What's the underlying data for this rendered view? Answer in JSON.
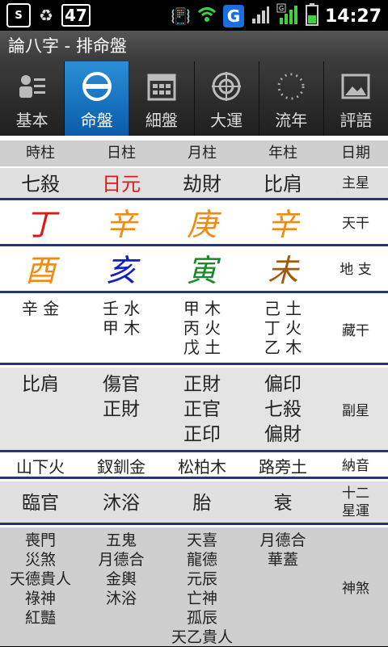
{
  "status_bar": {
    "battery_level": "47",
    "time": "14:27",
    "g_app_label": "G",
    "network_label": "3G"
  },
  "app": {
    "title": "論八字 - 排命盤"
  },
  "tabs": [
    {
      "label": "基本",
      "icon": "person-card-icon",
      "active": false
    },
    {
      "label": "命盤",
      "icon": "disc-icon",
      "active": true
    },
    {
      "label": "細盤",
      "icon": "grid-calendar-icon",
      "active": false
    },
    {
      "label": "大運",
      "icon": "compass-icon",
      "active": false
    },
    {
      "label": "流年",
      "icon": "dotted-circle-icon",
      "active": false
    },
    {
      "label": "評語",
      "icon": "picture-icon",
      "active": false
    }
  ],
  "columns": [
    "時柱",
    "日柱",
    "月柱",
    "年柱"
  ],
  "label_header": "日期",
  "rows": {
    "main_star": {
      "label": "主星",
      "values": [
        "七殺",
        "日元",
        "劫財",
        "比肩"
      ]
    },
    "heavenly_stems": {
      "label": "天干",
      "values": [
        "丁",
        "辛",
        "庚",
        "辛"
      ],
      "colors": [
        "#e01818",
        "#f08a10",
        "#f08a10",
        "#f08a10"
      ]
    },
    "earthly_branches": {
      "label": "地 支",
      "values": [
        "酉",
        "亥",
        "寅",
        "未"
      ],
      "colors": [
        "#f08a10",
        "#1020c0",
        "#188a28",
        "#a05a10"
      ]
    },
    "hidden_stems": {
      "label": "藏干",
      "values": [
        [
          "辛 金"
        ],
        [
          "壬 水",
          "甲 木"
        ],
        [
          "甲 木",
          "丙 火",
          "戊 土"
        ],
        [
          "己 土",
          "丁 火",
          "乙 木"
        ]
      ]
    },
    "sub_stars": {
      "label": "副星",
      "values": [
        [
          "比肩"
        ],
        [
          "傷官",
          "正財"
        ],
        [
          "正財",
          "正官",
          "正印"
        ],
        [
          "偏印",
          "七殺",
          "偏財"
        ]
      ]
    },
    "nayin": {
      "label": "納音",
      "values": [
        "山下火",
        "釵釧金",
        "松柏木",
        "路旁土"
      ]
    },
    "life_stages": {
      "label_line1": "十二",
      "label_line2": "星運",
      "values": [
        "臨官",
        "沐浴",
        "胎",
        "衰"
      ]
    },
    "shensha": {
      "label": "神煞",
      "values": [
        [
          "喪門",
          "災煞",
          "天德貴人",
          "祿神",
          "紅豔"
        ],
        [
          "五鬼",
          "月德合",
          "金輿",
          "沐浴"
        ],
        [
          "天喜",
          "龍德",
          "元辰",
          "亡神",
          "孤辰",
          "天乙貴人"
        ],
        [
          "月德合",
          "華蓋"
        ]
      ]
    }
  },
  "colors": {
    "day_master": "#e01818",
    "tab_active": "#1a78c8",
    "row_divider": "#2a3570"
  }
}
